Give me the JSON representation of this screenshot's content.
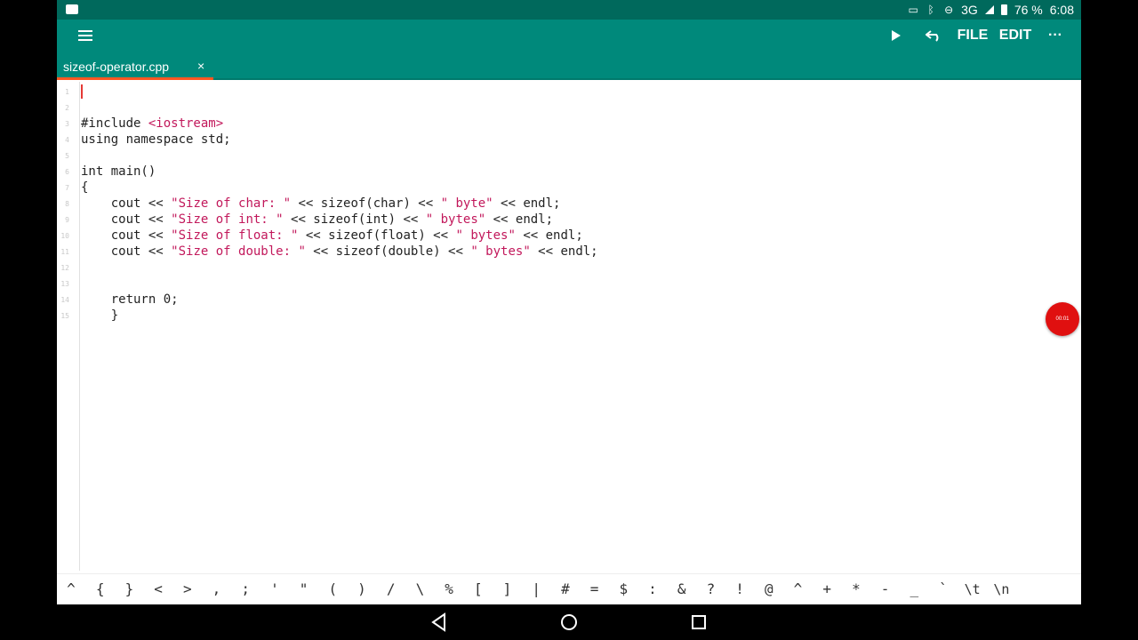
{
  "status_bar": {
    "network": "3G",
    "battery_percent": "76 %",
    "time": "6:08"
  },
  "toolbar": {
    "file_label": "FILE",
    "edit_label": "EDIT",
    "more_label": "···"
  },
  "tab": {
    "filename": "sizeof-operator.cpp",
    "close_label": "×"
  },
  "editor": {
    "line_numbers": [
      "1",
      "2",
      "3",
      "4",
      "5",
      "6",
      "7",
      "8",
      "9",
      "10",
      "11",
      "12",
      "13",
      "14",
      "15"
    ],
    "lines": [
      "",
      "",
      "#include <iostream>",
      "using namespace std;",
      "",
      "int main()",
      "{",
      "    cout << \"Size of char: \" << sizeof(char) << \" byte\" << endl;",
      "    cout << \"Size of int: \" << sizeof(int) << \" bytes\" << endl;",
      "    cout << \"Size of float: \" << sizeof(float) << \" bytes\" << endl;",
      "    cout << \"Size of double: \" << sizeof(double) << \" bytes\" << endl;",
      "",
      "",
      "    return 0;",
      "    }"
    ]
  },
  "recorder": {
    "timer": "00:01"
  },
  "symbols": [
    "^",
    "{",
    "}",
    "<",
    ">",
    ",",
    ";",
    "'",
    "\"",
    "(",
    ")",
    "/",
    "\\",
    "%",
    "[",
    "]",
    "|",
    "#",
    "=",
    "$",
    ":",
    "&",
    "?",
    "!",
    "@",
    "^",
    "+",
    "*",
    "-",
    "_",
    "`",
    "\\t",
    "\\n"
  ]
}
